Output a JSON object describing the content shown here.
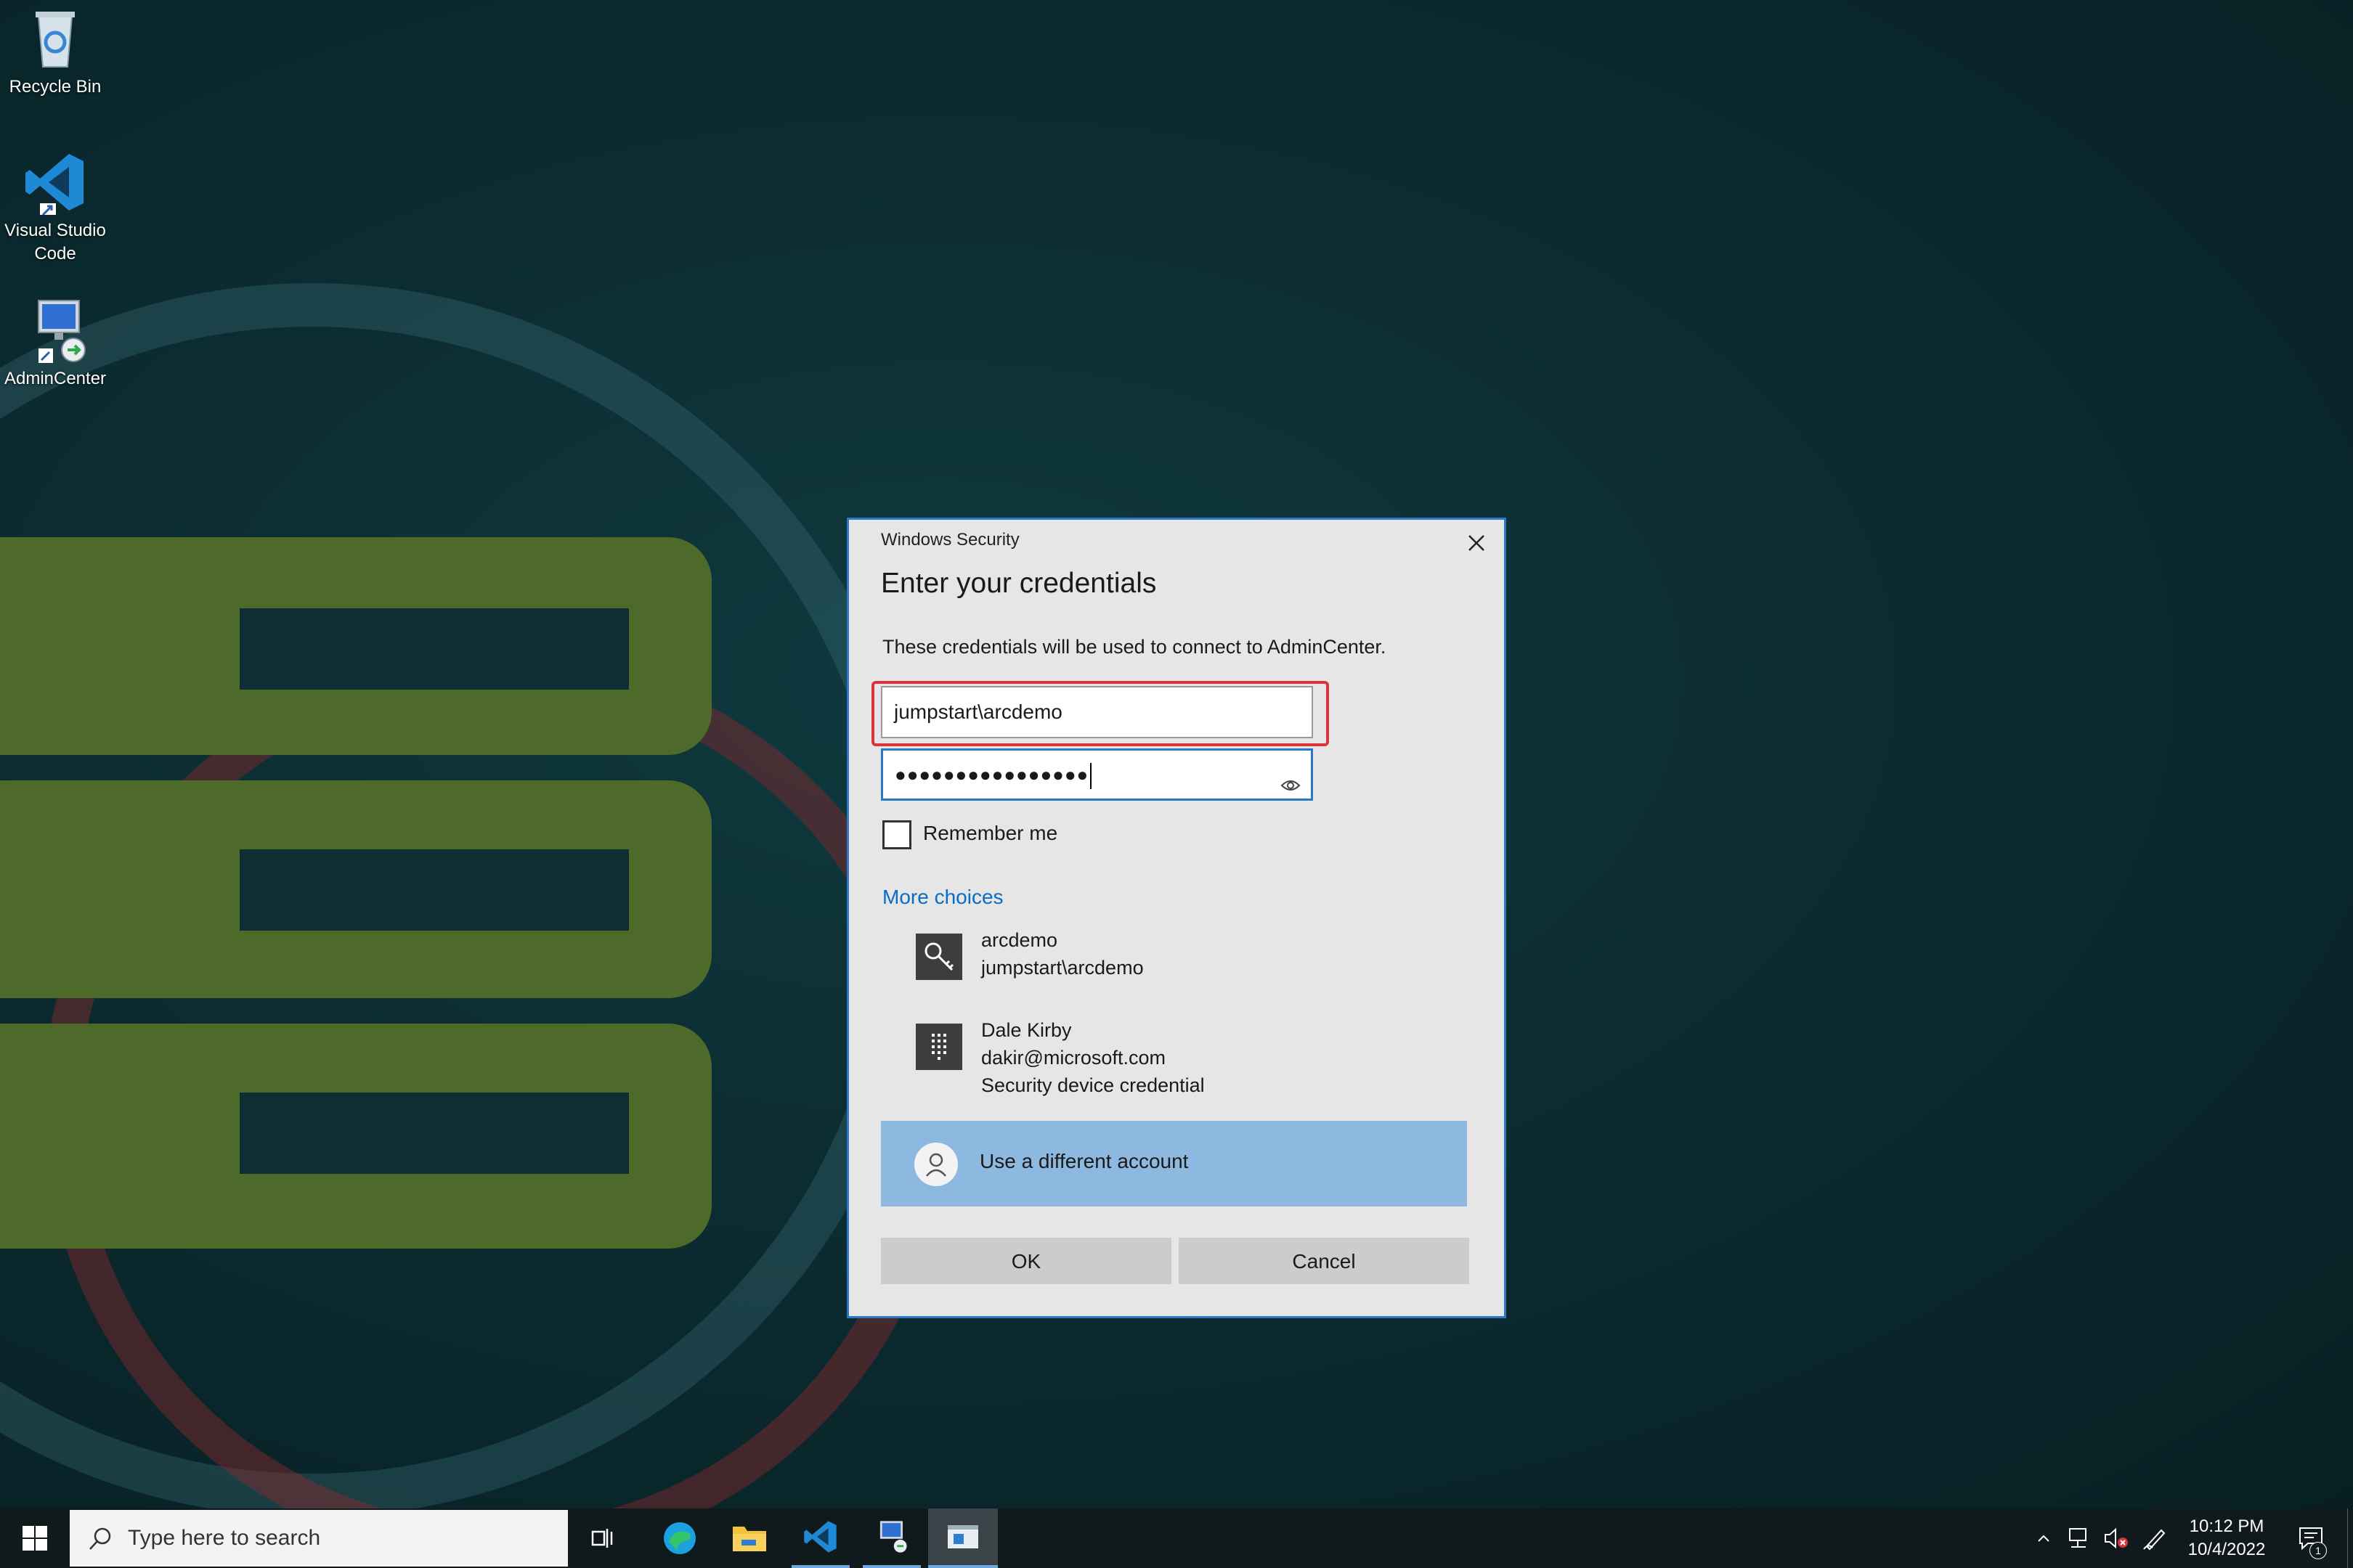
{
  "desktop": {
    "icons": [
      {
        "label": "Recycle Bin",
        "icon": "recycle-bin-icon"
      },
      {
        "label": "Visual Studio Code",
        "icon": "vscode-icon"
      },
      {
        "label": "AdminCenter",
        "icon": "remote-desktop-icon"
      }
    ]
  },
  "dialog": {
    "window_title": "Windows Security",
    "heading": "Enter your credentials",
    "description": "These credentials will be used to connect to AdminCenter.",
    "username_value": "jumpstart\\arcdemo",
    "password_masked": "●●●●●●●●●●●●●●●●",
    "remember_label": "Remember me",
    "remember_checked": false,
    "more_choices": "More choices",
    "accounts": [
      {
        "name": "arcdemo",
        "detail": "jumpstart\\arcdemo",
        "icon": "key-icon"
      },
      {
        "name": "Dale Kirby",
        "detail": "dakir@microsoft.com",
        "extra": "Security device credential",
        "icon": "keypad-icon"
      }
    ],
    "different_account": "Use a different account",
    "ok_label": "OK",
    "cancel_label": "Cancel",
    "accent_color": "#2b78c6",
    "highlight_color": "#d9353a"
  },
  "taskbar": {
    "search_placeholder": "Type here to search",
    "time": "10:12 PM",
    "date": "10/4/2022",
    "notification_count": "1"
  }
}
